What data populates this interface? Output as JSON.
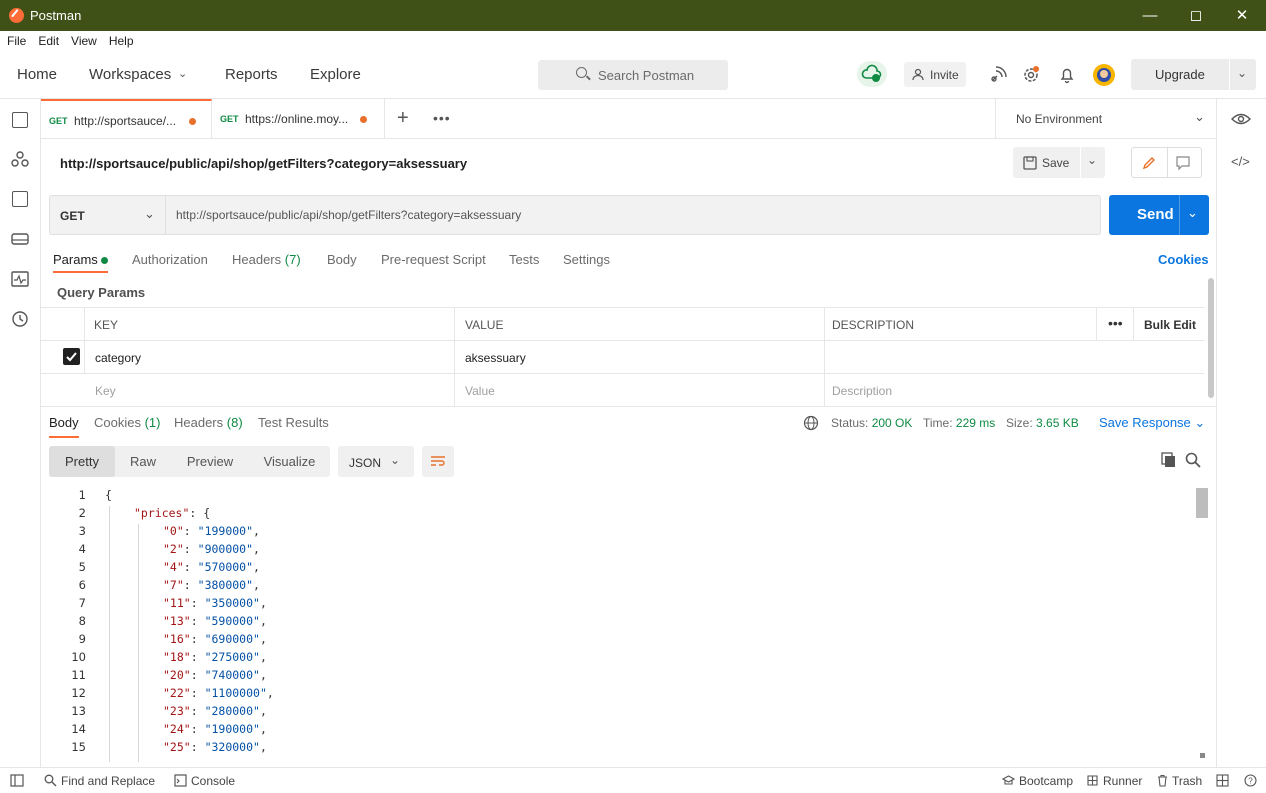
{
  "window": {
    "title": "Postman"
  },
  "menu": [
    "File",
    "Edit",
    "View",
    "Help"
  ],
  "nav": {
    "home": "Home",
    "workspaces": "Workspaces",
    "reports": "Reports",
    "explore": "Explore"
  },
  "search": {
    "placeholder": "Search Postman"
  },
  "header": {
    "invite": "Invite",
    "upgrade": "Upgrade"
  },
  "tabs": [
    {
      "method": "GET",
      "url": "http://sportsauce/..."
    },
    {
      "method": "GET",
      "url": "https://online.moy..."
    }
  ],
  "environment": {
    "label": "No Environment"
  },
  "request": {
    "title": "http://sportsauce/public/api/shop/getFilters?category=aksessuary",
    "save": "Save",
    "method": "GET",
    "url": "http://sportsauce/public/api/shop/getFilters?category=aksessuary",
    "send": "Send"
  },
  "request_tabs": {
    "params": "Params",
    "authorization": "Authorization",
    "headers": "Headers",
    "headers_count": "(7)",
    "body": "Body",
    "prerequest": "Pre-request Script",
    "tests": "Tests",
    "settings": "Settings",
    "cookies": "Cookies"
  },
  "query_params": {
    "title": "Query Params",
    "columns": {
      "key": "KEY",
      "value": "VALUE",
      "description": "DESCRIPTION",
      "bulk_edit": "Bulk Edit"
    },
    "rows": [
      {
        "key": "category",
        "value": "aksessuary",
        "checked": true
      }
    ],
    "placeholders": {
      "key": "Key",
      "value": "Value",
      "description": "Description"
    }
  },
  "response": {
    "tabs": {
      "body": "Body",
      "cookies": "Cookies",
      "cookies_count": "(1)",
      "headers": "Headers",
      "headers_count": "(8)",
      "test_results": "Test Results"
    },
    "status_label": "Status:",
    "status_value": "200 OK",
    "time_label": "Time:",
    "time_value": "229 ms",
    "size_label": "Size:",
    "size_value": "3.65 KB",
    "save_response": "Save Response",
    "views": [
      "Pretty",
      "Raw",
      "Preview",
      "Visualize"
    ],
    "format": "JSON"
  },
  "code_lines": [
    {
      "n": "1",
      "indent": 0,
      "text": "{"
    },
    {
      "n": "2",
      "indent": 1,
      "key": "\"prices\"",
      "rest": ": {"
    },
    {
      "n": "3",
      "indent": 2,
      "key": "\"0\"",
      "val": "\"199000\""
    },
    {
      "n": "4",
      "indent": 2,
      "key": "\"2\"",
      "val": "\"900000\""
    },
    {
      "n": "5",
      "indent": 2,
      "key": "\"4\"",
      "val": "\"570000\""
    },
    {
      "n": "6",
      "indent": 2,
      "key": "\"7\"",
      "val": "\"380000\""
    },
    {
      "n": "7",
      "indent": 2,
      "key": "\"11\"",
      "val": "\"350000\""
    },
    {
      "n": "8",
      "indent": 2,
      "key": "\"13\"",
      "val": "\"590000\""
    },
    {
      "n": "9",
      "indent": 2,
      "key": "\"16\"",
      "val": "\"690000\""
    },
    {
      "n": "10",
      "indent": 2,
      "key": "\"18\"",
      "val": "\"275000\""
    },
    {
      "n": "11",
      "indent": 2,
      "key": "\"20\"",
      "val": "\"740000\""
    },
    {
      "n": "12",
      "indent": 2,
      "key": "\"22\"",
      "val": "\"1100000\""
    },
    {
      "n": "13",
      "indent": 2,
      "key": "\"23\"",
      "val": "\"280000\""
    },
    {
      "n": "14",
      "indent": 2,
      "key": "\"24\"",
      "val": "\"190000\""
    },
    {
      "n": "15",
      "indent": 2,
      "key": "\"25\"",
      "val": "\"320000\""
    }
  ],
  "statusbar": {
    "find_replace": "Find and Replace",
    "console": "Console",
    "bootcamp": "Bootcamp",
    "runner": "Runner",
    "trash": "Trash"
  },
  "colors": {
    "titlebar": "#3f5116",
    "accent": "#ff6c37",
    "send": "#0b76e0",
    "success": "#0f8a43"
  }
}
